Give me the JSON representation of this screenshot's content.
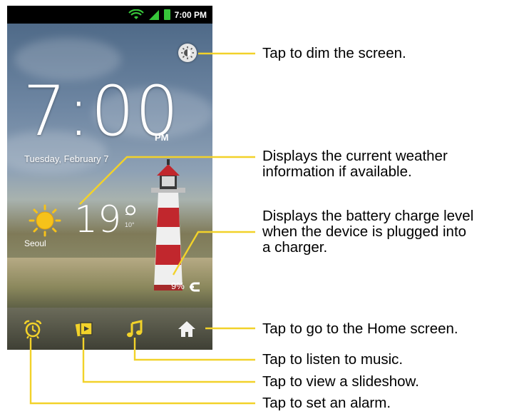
{
  "status_bar": {
    "time": "7:00 PM",
    "icons": [
      "wifi-icon",
      "signal-icon",
      "battery-icon"
    ]
  },
  "clock": {
    "time": "7:00",
    "ampm": "PM",
    "date": "Tuesday, February 7"
  },
  "weather": {
    "icon": "sun-icon",
    "city": "Seoul",
    "temperature": "19°",
    "high": "–",
    "low": "10°"
  },
  "battery": {
    "percent": "9%",
    "icon": "charging-icon"
  },
  "dim_button": {
    "icon": "brightness-icon"
  },
  "dock": {
    "items": [
      {
        "name": "alarm",
        "icon": "alarm-clock-icon"
      },
      {
        "name": "slideshow",
        "icon": "slideshow-icon"
      },
      {
        "name": "music",
        "icon": "music-note-icon"
      },
      {
        "name": "home",
        "icon": "home-icon"
      }
    ]
  },
  "callouts": {
    "dim": "Tap to dim the screen.",
    "weather_line1": "Displays the current weather",
    "weather_line2": "information if available.",
    "battery_line1": "Displays the battery charge level",
    "battery_line2": "when the device is plugged into",
    "battery_line3": "a charger.",
    "home": "Tap to go to the Home screen.",
    "music": "Tap to listen to music.",
    "slideshow": "Tap to view a slideshow.",
    "alarm": "Tap to set an alarm."
  },
  "colors": {
    "callout_line": "#f2d22a",
    "sun": "#f6c21a",
    "battery_green": "#37c63a"
  }
}
